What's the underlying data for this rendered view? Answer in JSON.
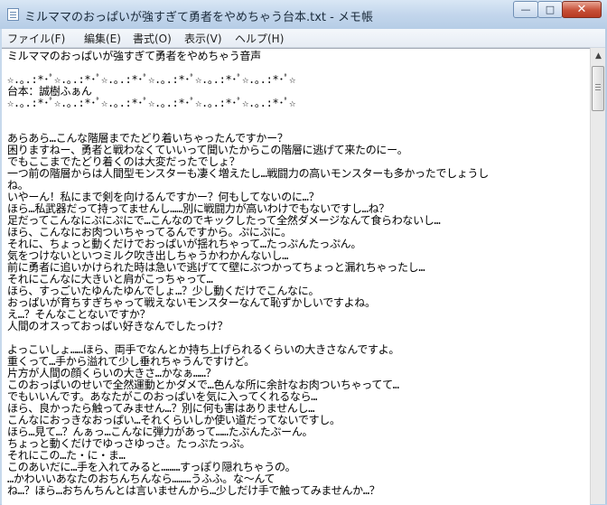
{
  "window": {
    "title": "ミルママのおっぱいが強すぎて勇者をやめちゃう台本.txt - メモ帳"
  },
  "caption_buttons": {
    "minimize": "—",
    "maximize": "□",
    "close": "✕"
  },
  "menu": [
    {
      "label": "ファイル(F)"
    },
    {
      "label": "編集(E)"
    },
    {
      "label": "書式(O)"
    },
    {
      "label": "表示(V)"
    },
    {
      "label": "ヘルプ(H)"
    }
  ],
  "editor": {
    "lines": [
      "ミルママのおっぱいが強すぎて勇者をやめちゃう音声",
      "",
      "☆.｡.:*･ﾟ☆.｡.:*･ﾟ☆.｡.:*･ﾟ☆.｡.:*･ﾟ☆.｡.:*･ﾟ☆.｡.:*･ﾟ☆",
      "台本：誠樹ふぁん",
      "☆.｡.:*･ﾟ☆.｡.:*･ﾟ☆.｡.:*･ﾟ☆.｡.:*･ﾟ☆.｡.:*･ﾟ☆.｡.:*･ﾟ☆",
      "",
      "",
      "あらあら…こんな階層までたどり着いちゃったんですかー？",
      "困りますねー、勇者と戦わなくていいって聞いたからこの階層に逃げて来たのにー。",
      "でもここまでたどり着くのは大変だったでしょ？",
      "一つ前の階層からは人間型モンスターも凄く増えたし…戦闘力の高いモンスターも多かったでしょうし",
      "ね。",
      "いやーん！私にまで剣を向けるんですかー？何もしてないのに…？",
      "ほら…私武器だって持ってませんし……別に戦闘力が高いわけでもないですし…ね？",
      "足だってこんなにぷにぷにで…こんなのでキックしたって全然ダメージなんて食らわないし…",
      "ほら、こんなにお肉ついちゃってるんですから。ぷにぷに。",
      "それに、ちょっと動くだけでおっぱいが揺れちゃって…たっぷんたっぷん。",
      "気をつけないといつミルク吹き出しちゃうかわかんないし…",
      "前に勇者に追いかけられた時は急いで逃げてて壁にぶつかってちょっと漏れちゃったし…",
      "それにこんなに大きいと肩がこっちゃって…",
      "ほら、すっごいたゆんたゆんでしょ…？少し動くだけでこんなに。",
      "おっぱいが育ちすぎちゃって戦えないモンスターなんて恥ずかしいですよね。",
      "え…？そんなことないですか？",
      "人間のオスっておっぱい好きなんでしたっけ？",
      "",
      "よっこいしょ……ほら、両手でなんとか持ち上げられるくらいの大きさなんですよ。",
      "重くって…手から溢れて少し垂れちゃうんですけど。",
      "片方が人間の顔くらいの大きさ…かなぁ……？",
      "このおっぱいのせいで全然運動とかダメで…色んな所に余計なお肉ついちゃってて…",
      "でもいいんです。あなたがこのおっぱいを気に入ってくれるなら…",
      "ほら、良かったら触ってみません…？別に何も害はありませんし…",
      "こんなにおっきなおっぱい…それくらいしか使い道だってないですし。",
      "ほら…見て…？んぁっ…こんなに弾力があって……たぷんたぷーん。",
      "ちょっと動くだけでゆっさゆっさ。たっぷたっぷ。",
      "それにこの…た・に・ま…",
      "このあいだに…手を入れてみると………すっぽり隠れちゃうの。",
      "…かわいいあなたのおちんちんなら………うふふ。な～んて",
      "ね…？ほら…おちんちんとは言いませんから…少しだけ手で触ってみませんか…？"
    ]
  }
}
